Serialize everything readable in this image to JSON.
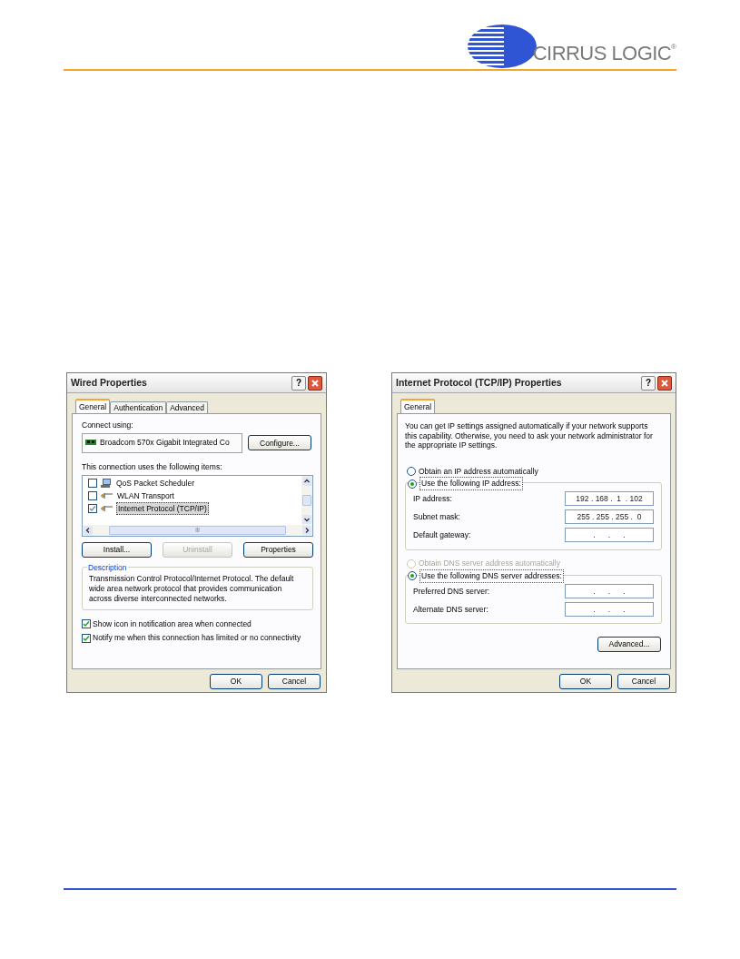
{
  "brand": {
    "name": "CIRRUS LOGIC",
    "mark": "®"
  },
  "wired_dialog": {
    "title": "Wired Properties",
    "help": "?",
    "tabs": [
      {
        "label": "General",
        "selected": true
      },
      {
        "label": "Authentication",
        "selected": false
      },
      {
        "label": "Advanced",
        "selected": false
      }
    ],
    "connect_label": "Connect using:",
    "adapter": "Broadcom 570x Gigabit Integrated Co",
    "configure": "Configure...",
    "items_label": "This connection uses the following items:",
    "items": [
      {
        "name": "QoS Packet Scheduler",
        "checked": false,
        "selected": false,
        "kind": "scheduler"
      },
      {
        "name": "WLAN Transport",
        "checked": false,
        "selected": false,
        "kind": "protocol"
      },
      {
        "name": "Internet Protocol (TCP/IP)",
        "checked": true,
        "selected": true,
        "kind": "protocol"
      }
    ],
    "actions": [
      {
        "label": "Install...",
        "disabled": false
      },
      {
        "label": "Uninstall",
        "disabled": true
      },
      {
        "label": "Properties",
        "disabled": false
      }
    ],
    "description": {
      "legend": "Description",
      "text": "Transmission Control Protocol/Internet Protocol. The default wide area network protocol that provides communication across diverse interconnected networks."
    },
    "options": [
      {
        "label": "Show icon in notification area when connected",
        "checked": true
      },
      {
        "label": "Notify me when this connection has limited or no connectivity",
        "checked": true
      }
    ],
    "footer": [
      "OK",
      "Cancel"
    ]
  },
  "tcpip_dialog": {
    "title": "Internet Protocol (TCP/IP) Properties",
    "help": "?",
    "tabs": [
      {
        "label": "General",
        "selected": true
      }
    ],
    "intro": "You can get IP settings assigned automatically if your network supports this capability. Otherwise, you need to ask your network administrator for the appropriate IP settings.",
    "ip_auto": {
      "label": "Obtain an IP address automatically",
      "selected": false,
      "disabled": false
    },
    "ip_manual": {
      "label": "Use the following IP address:",
      "selected": true,
      "disabled": false
    },
    "ip_fields": [
      {
        "label": "IP address:",
        "value": "192 . 168 .  1  . 102"
      },
      {
        "label": "Subnet mask:",
        "value": "255 . 255 . 255 .  0"
      },
      {
        "label": "Default gateway:",
        "value": ".      .      ."
      }
    ],
    "dns_auto": {
      "label": "Obtain DNS server address automatically",
      "selected": false,
      "disabled": true
    },
    "dns_manual": {
      "label": "Use the following DNS server addresses:",
      "selected": true,
      "disabled": false
    },
    "dns_fields": [
      {
        "label": "Preferred DNS server:",
        "value": ".      .      ."
      },
      {
        "label": "Alternate DNS server:",
        "value": ".      .      ."
      }
    ],
    "advanced": "Advanced...",
    "footer": [
      "OK",
      "Cancel"
    ]
  }
}
